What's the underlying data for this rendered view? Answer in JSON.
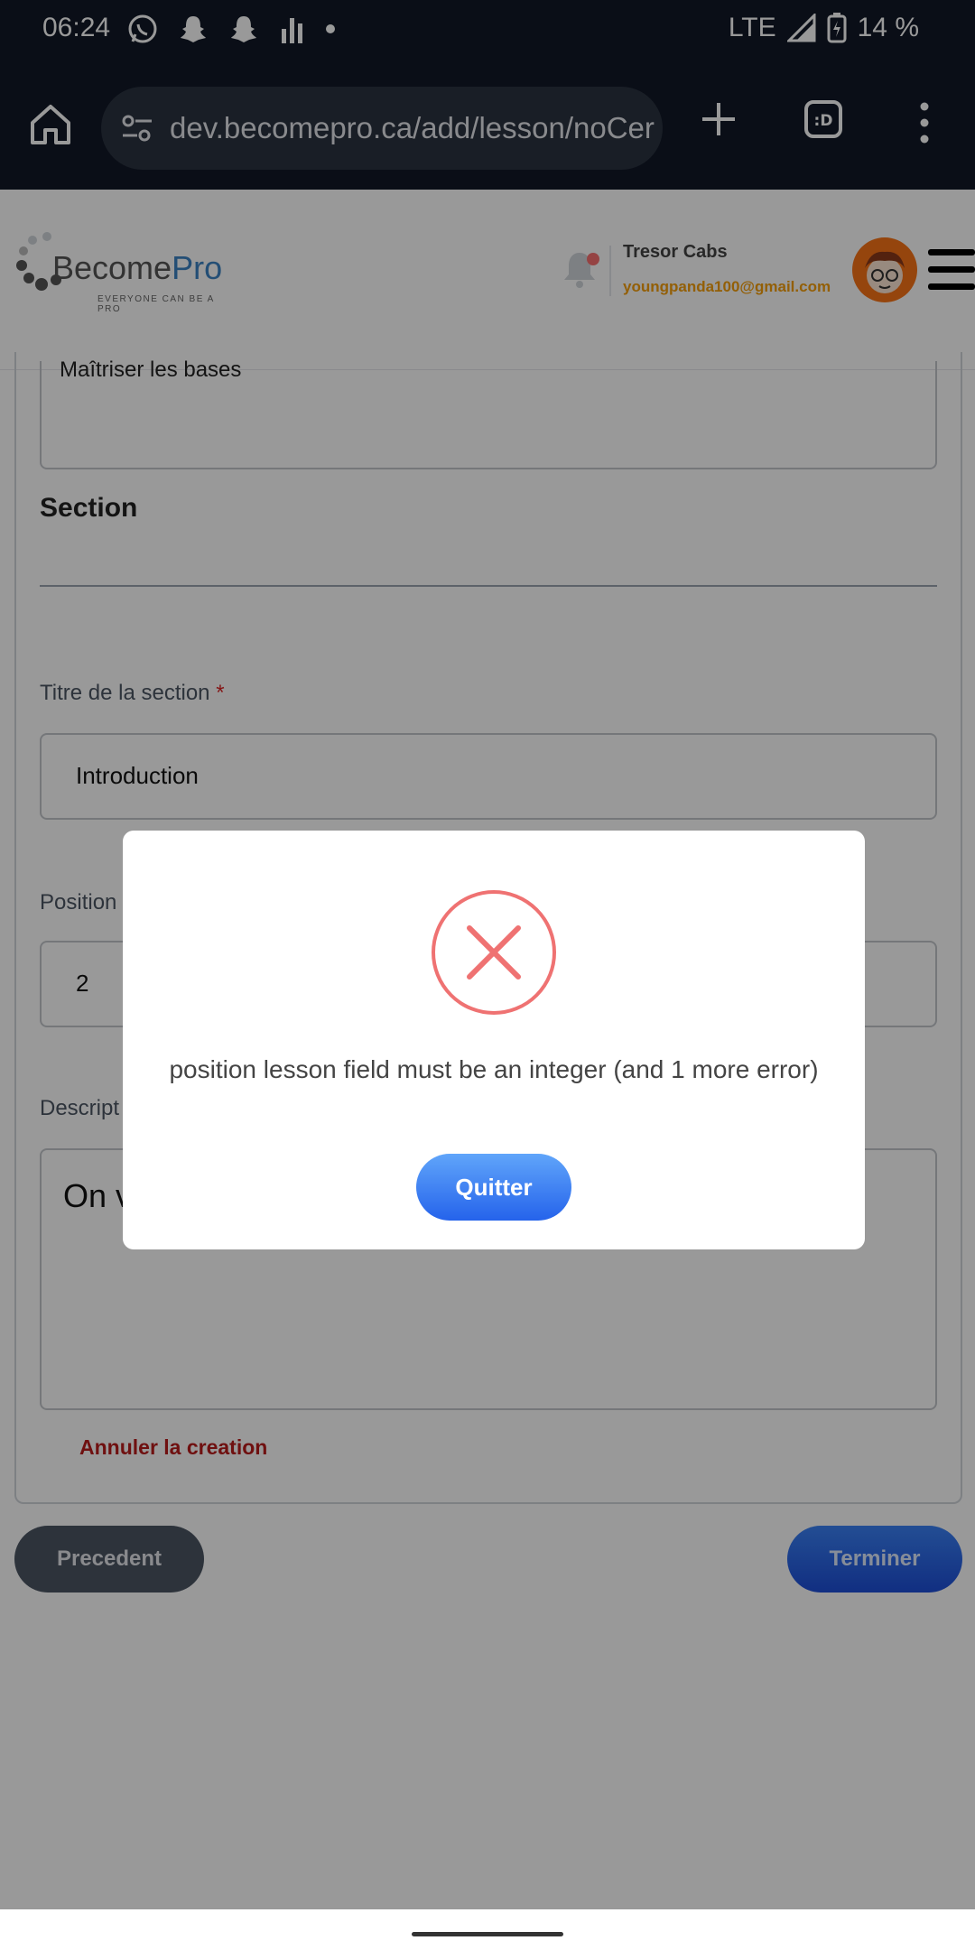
{
  "status_bar": {
    "time": "06:24",
    "network": "LTE",
    "battery": "14 %",
    "notification_icons": [
      "whatsapp-icon",
      "snapchat-icon",
      "snapchat-icon",
      "signal-bars-icon",
      "dot-icon"
    ]
  },
  "browser": {
    "url": "dev.becomepro.ca/add/lesson/noCer"
  },
  "header": {
    "logo_main": "Become",
    "logo_accent": "Pro",
    "logo_tagline": "EVERYONE CAN BE A PRO",
    "user_name": "Tresor Cabs",
    "user_email": "youngpanda100@gmail.com"
  },
  "form": {
    "top_textarea_value": "Maîtriser les bases",
    "section_title": "Section",
    "section_title_label": "Titre de la section",
    "required_mark": "*",
    "section_title_value": "Introduction",
    "position_label": "Position",
    "position_value": "2",
    "description_label": "Descript",
    "description_value": "On v",
    "cancel_label": "Annuler la creation"
  },
  "footer_buttons": {
    "previous": "Precedent",
    "finish": "Terminer"
  },
  "modal": {
    "message": "position lesson field must be an integer (and 1 more error)",
    "button": "Quitter",
    "icon": "error-x-icon"
  },
  "colors": {
    "status_bg": "#111827",
    "accent_blue": "#2563eb",
    "error_red": "#ef7272",
    "email_orange": "#f59e0b"
  }
}
